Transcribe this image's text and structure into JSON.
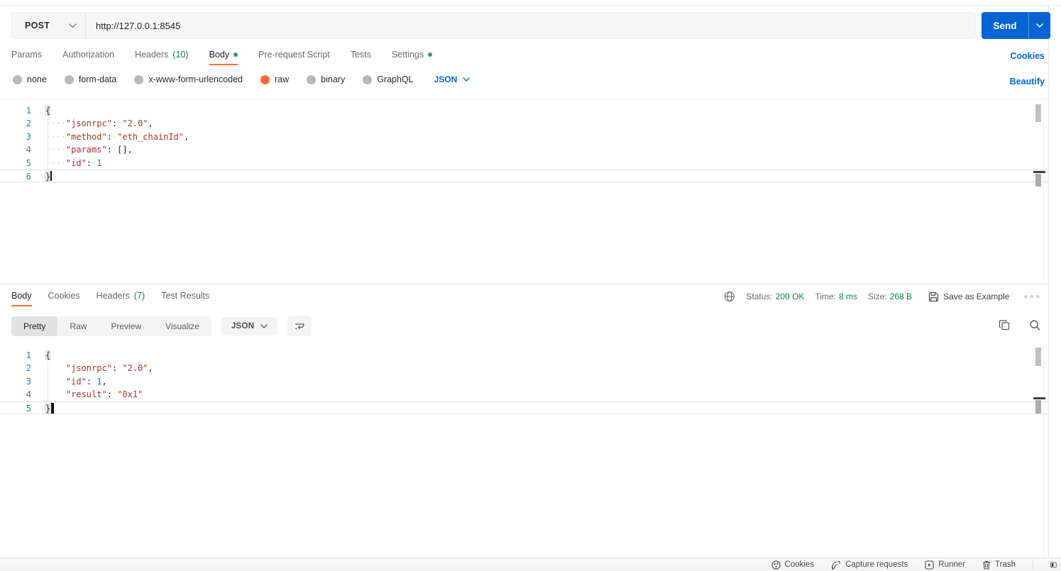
{
  "request": {
    "method": "POST",
    "url": "http://127.0.0.1:8545",
    "send_label": "Send",
    "tabs": [
      {
        "label": "Params"
      },
      {
        "label": "Authorization"
      },
      {
        "label": "Headers",
        "count": "(10)"
      },
      {
        "label": "Body"
      },
      {
        "label": "Pre-request Script"
      },
      {
        "label": "Tests"
      },
      {
        "label": "Settings"
      }
    ],
    "cookies_link": "Cookies",
    "body_modes": [
      {
        "label": "none"
      },
      {
        "label": "form-data"
      },
      {
        "label": "x-www-form-urlencoded"
      },
      {
        "label": "raw"
      },
      {
        "label": "binary"
      },
      {
        "label": "GraphQL"
      }
    ],
    "language_select": "JSON",
    "beautify_link": "Beautify",
    "editor_lines": [
      {
        "num": "1",
        "tokens": [
          [
            "b",
            "{"
          ]
        ]
      },
      {
        "num": "2",
        "guide": true,
        "tokens": [
          [
            "w",
            "····"
          ],
          [
            "k",
            "\"jsonrpc\""
          ],
          [
            "p",
            ":"
          ],
          [
            "w",
            "·"
          ],
          [
            "s",
            "\"2.0\""
          ],
          [
            "p",
            ","
          ]
        ]
      },
      {
        "num": "3",
        "guide": true,
        "tokens": [
          [
            "w",
            "····"
          ],
          [
            "k",
            "\"method\""
          ],
          [
            "p",
            ":"
          ],
          [
            "w",
            "·"
          ],
          [
            "s",
            "\"eth_chainId\""
          ],
          [
            "p",
            ","
          ]
        ]
      },
      {
        "num": "4",
        "guide": true,
        "tokens": [
          [
            "w",
            "····"
          ],
          [
            "k",
            "\"params\""
          ],
          [
            "p",
            ":"
          ],
          [
            "w",
            "·"
          ],
          [
            "p",
            "[],"
          ]
        ]
      },
      {
        "num": "5",
        "guide": true,
        "tokens": [
          [
            "w",
            "····"
          ],
          [
            "k",
            "\"id\""
          ],
          [
            "p",
            ":"
          ],
          [
            "w",
            "·"
          ],
          [
            "n",
            "1"
          ]
        ]
      },
      {
        "num": "6",
        "current": true,
        "cursor": "thin",
        "tokens": [
          [
            "b",
            "}"
          ]
        ]
      }
    ]
  },
  "response": {
    "tabs": [
      {
        "label": "Body"
      },
      {
        "label": "Cookies"
      },
      {
        "label": "Headers",
        "count": "(7)"
      },
      {
        "label": "Test Results"
      }
    ],
    "meta": {
      "status_label": "Status:",
      "status_value": "200 OK",
      "time_label": "Time:",
      "time_value": "8 ms",
      "size_label": "Size:",
      "size_value": "268 B",
      "save_as_example": "Save as Example",
      "more_menu": "∘∘∘"
    },
    "view_tabs": [
      {
        "label": "Pretty"
      },
      {
        "label": "Raw"
      },
      {
        "label": "Preview"
      },
      {
        "label": "Visualize"
      }
    ],
    "language_select": "JSON",
    "editor_lines": [
      {
        "num": "1",
        "tokens": [
          [
            "b",
            "{"
          ]
        ]
      },
      {
        "num": "2",
        "guide": true,
        "tokens": [
          [
            "p",
            "    "
          ],
          [
            "k",
            "\"jsonrpc\""
          ],
          [
            "p",
            ": "
          ],
          [
            "s",
            "\"2.0\""
          ],
          [
            "p",
            ","
          ]
        ]
      },
      {
        "num": "3",
        "guide": true,
        "tokens": [
          [
            "p",
            "    "
          ],
          [
            "k",
            "\"id\""
          ],
          [
            "p",
            ": "
          ],
          [
            "n",
            "1"
          ],
          [
            "p",
            ","
          ]
        ]
      },
      {
        "num": "4",
        "guide": true,
        "tokens": [
          [
            "p",
            "    "
          ],
          [
            "k",
            "\"result\""
          ],
          [
            "p",
            ": "
          ],
          [
            "s",
            "\"0x1\""
          ]
        ]
      },
      {
        "num": "5",
        "current": true,
        "cursor": "block",
        "tokens": [
          [
            "b",
            "}"
          ]
        ]
      }
    ]
  },
  "status_bar": {
    "items": [
      {
        "label": "Cookies"
      },
      {
        "label": "Capture requests"
      },
      {
        "label": "Runner"
      },
      {
        "label": "Trash"
      }
    ]
  },
  "colors": {
    "accent_orange": "#ff6c37",
    "green": "#0e8345",
    "blue": "#0265d2",
    "code_string": "#ad352b",
    "code_number": "#0f8767",
    "line_number": "#2f7eaa"
  }
}
